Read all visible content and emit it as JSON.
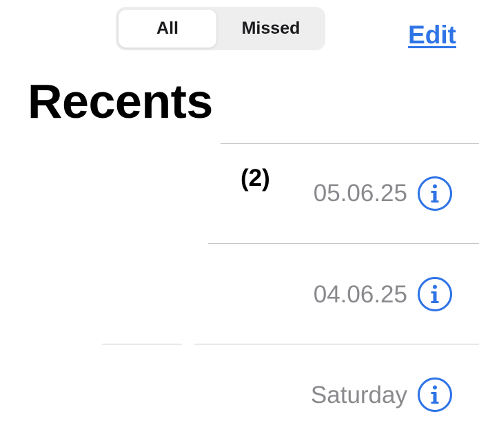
{
  "header": {
    "segments": [
      {
        "label": "All",
        "selected": true
      },
      {
        "label": "Missed",
        "selected": false
      }
    ],
    "edit_label": "Edit",
    "title": "Recents"
  },
  "recents": [
    {
      "count": "(2)",
      "date": "05.06.25"
    },
    {
      "count": "",
      "date": "04.06.25"
    },
    {
      "count": "",
      "date": "Saturday"
    }
  ],
  "colors": {
    "accent": "#2f74e6",
    "secondary_text": "#8a8a8e",
    "divider": "#c6c6c8",
    "segment_background": "#eeeeef"
  },
  "icons": {
    "info": "info-circle-icon"
  }
}
